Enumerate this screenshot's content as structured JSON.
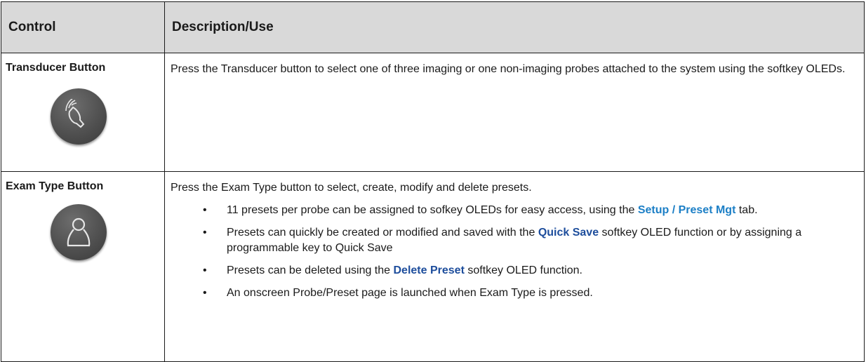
{
  "table": {
    "headers": {
      "control": "Control",
      "description": "Description/Use"
    },
    "rows": [
      {
        "control": "Transducer Button",
        "icon": "transducer-probe-icon",
        "description": "Press the Transducer button to select one of three imaging or one non-imaging probes attached to the system using the softkey OLEDs."
      },
      {
        "control": "Exam Type Button",
        "icon": "exam-type-person-icon",
        "intro": "Press the Exam Type button to select, create, modify and delete presets.",
        "bullets": [
          {
            "pre": "11 presets per probe can be assigned to sofkey OLEDs for easy access, using the",
            "link": "Setup / Preset Mgt",
            "post": "tab."
          },
          {
            "pre": "Presets can quickly be created or modified and saved with the",
            "link": "Quick Save",
            "post": "softkey OLED function or by assigning a programmable key to Quick Save"
          },
          {
            "pre": "Presets can be deleted using the",
            "link": "Delete Preset",
            "post": "softkey OLED function."
          },
          {
            "text": "An onscreen Probe/Preset page is launched when Exam Type is pressed."
          }
        ]
      }
    ]
  },
  "colors": {
    "header_bg": "#d9d9d9",
    "link_light": "#1c7fc6",
    "link_dark": "#1d4d9c"
  }
}
